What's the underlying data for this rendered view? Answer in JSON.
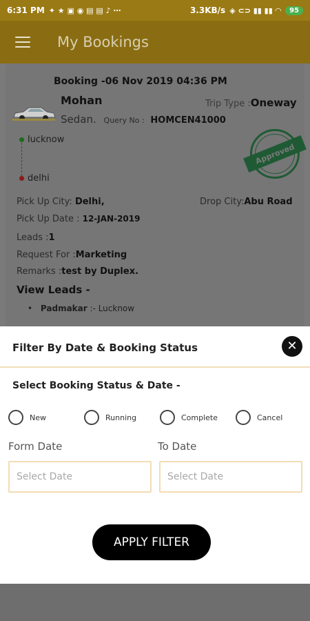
{
  "statusbar": {
    "time": "6:31 PM",
    "network_speed": "3.3KB/s",
    "battery": "95"
  },
  "appbar": {
    "title": "My Bookings"
  },
  "booking": {
    "title": "Booking -06 Nov 2019 04:36 PM",
    "name": "Mohan",
    "trip_type_label": "Trip Type :",
    "trip_type_value": "Oneway",
    "vehicle": "Sedan.",
    "query_label": "Query No :",
    "query_value": "HOMCEN41000",
    "from_city": "lucknow",
    "to_city": "delhi",
    "status_stamp": "Approved",
    "pickup_city_label": "Pick Up City:",
    "pickup_city_value": "Delhi,",
    "drop_city_label": "Drop City:",
    "drop_city_value": "Abu Road",
    "pickup_date_label": "Pick Up Date :",
    "pickup_date_value": "12-JAN-2019",
    "leads_label": "Leads :",
    "leads_value": "1",
    "request_for_label": "Request For :",
    "request_for_value": "Marketing",
    "remarks_label": "Remarks :",
    "remarks_value": "test by Duplex.",
    "view_leads_label": "View Leads -",
    "leads": [
      {
        "name": "Padmakar",
        "sep": " :- ",
        "city": "Lucknow"
      }
    ]
  },
  "filter_sheet": {
    "title": "Filter By Date & Booking Status",
    "section_title": "Select Booking Status & Date -",
    "status_options": [
      "New",
      "Running",
      "Complete",
      "Cancel"
    ],
    "from_date_label": "Form Date",
    "to_date_label": "To Date",
    "from_date_placeholder": "Select Date",
    "to_date_placeholder": "Select Date",
    "apply_label": "APPLY FILTER"
  },
  "colors": {
    "appbar": "#8a6d12",
    "statusbar": "#9a7a14",
    "input_border": "#f3dcb3",
    "stamp": "#1f5a34"
  }
}
